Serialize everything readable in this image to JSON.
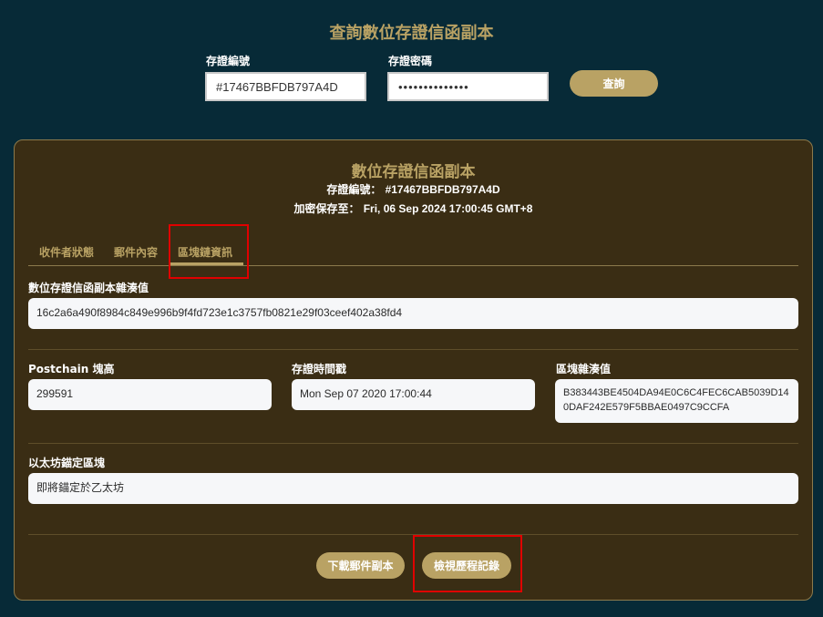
{
  "header": {
    "title": "查詢數位存證信函副本"
  },
  "search": {
    "cert_label": "存證編號",
    "cert_value": "#17467BBFDB797A4D",
    "password_label": "存證密碼",
    "password_value": "••••••••••••••",
    "query_button": "查詢"
  },
  "copy": {
    "title": "數位存證信函副本",
    "cert_label": "存證編號：",
    "cert_value": "#17467BBFDB797A4D",
    "kept_label": "加密保存至：",
    "kept_value": "Fri, 06 Sep 2024 17:00:45 GMT+8",
    "tabs": [
      {
        "label": "收件者狀態",
        "active": false
      },
      {
        "label": "郵件內容",
        "active": false
      },
      {
        "label": "區塊鏈資訊",
        "active": true
      }
    ],
    "hash_label": "數位存證信函副本雜湊值",
    "hash_value": "16c2a6a490f8984c849e996b9f4fd723e1c3757fb0821e29f03ceef402a38fd4",
    "block_height_label": "Postchain 塊高",
    "block_height_value": "299591",
    "timestamp_label": "存證時間戳",
    "timestamp_value": "Mon Sep 07 2020 17:00:44",
    "block_hash_label": "區塊雜湊值",
    "block_hash_value": "B383443BE4504DA94E0C6C4FEC6CAB5039D140DAF242E579F5BBAE0497C9CCFA",
    "eth_label": "以太坊錨定區塊",
    "eth_value": "即將錨定於乙太坊",
    "download_button": "下載郵件副本",
    "history_button": "檢視歷程記錄"
  },
  "colors": {
    "background": "#072a37",
    "panel": "#3a2d14",
    "gold": "#b9a264",
    "highlight": "#e00000"
  }
}
